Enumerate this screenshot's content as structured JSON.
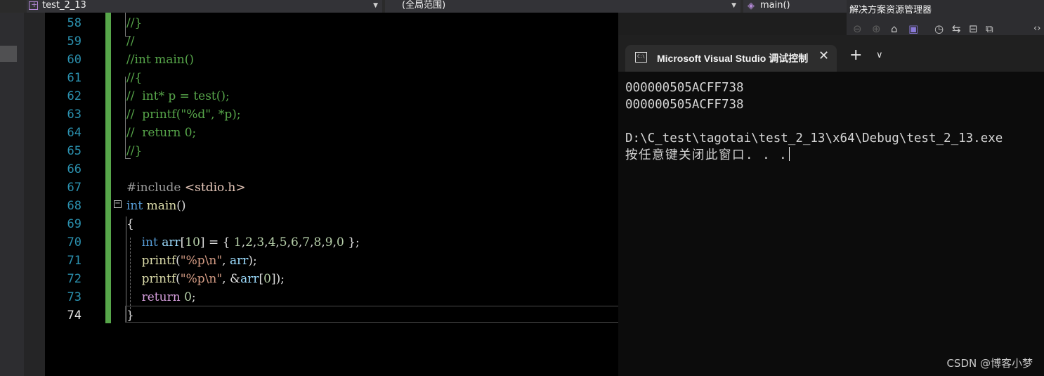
{
  "navbar": {
    "project": "test_2_13",
    "scope": "(全局范围)",
    "member": "main()"
  },
  "solution_explorer": {
    "title": "解决方案资源管理器"
  },
  "editor": {
    "lines": [
      {
        "n": "58",
        "text": "//}"
      },
      {
        "n": "59",
        "text": "//"
      },
      {
        "n": "60",
        "text": "//int main()"
      },
      {
        "n": "61",
        "text": "//{"
      },
      {
        "n": "62",
        "text": "//  int* p = test();"
      },
      {
        "n": "63",
        "text": "//  printf(\"%d\", *p);"
      },
      {
        "n": "64",
        "text": "//  return 0;"
      },
      {
        "n": "65",
        "text": "//}"
      },
      {
        "n": "66",
        "text": ""
      },
      {
        "n": "67",
        "text": "#include <stdio.h>"
      },
      {
        "n": "68",
        "text": "int main()"
      },
      {
        "n": "69",
        "text": "{"
      },
      {
        "n": "70",
        "text": "    int arr[10] = { 1,2,3,4,5,6,7,8,9,0 };"
      },
      {
        "n": "71",
        "text": "    printf(\"%p\\n\", arr);"
      },
      {
        "n": "72",
        "text": "    printf(\"%p\\n\", &arr[0]);"
      },
      {
        "n": "73",
        "text": "    return 0;"
      },
      {
        "n": "74",
        "text": "}"
      }
    ],
    "current_line": "74"
  },
  "console": {
    "tab_title": "Microsoft Visual Studio 调试控制台",
    "new_tab_symbol": "+",
    "output": [
      "000000505ACFF738",
      "000000505ACFF738",
      "",
      "D:\\C_test\\tagotai\\test_2_13\\x64\\Debug\\test_2_13.exe",
      "按任意键关闭此窗口. . ."
    ]
  },
  "watermark": "CSDN @博客小梦",
  "colors": {
    "comment": "#57a64a",
    "keyword": "#569cd6",
    "line_number": "#2b91af",
    "change_bar": "#57a64a"
  }
}
